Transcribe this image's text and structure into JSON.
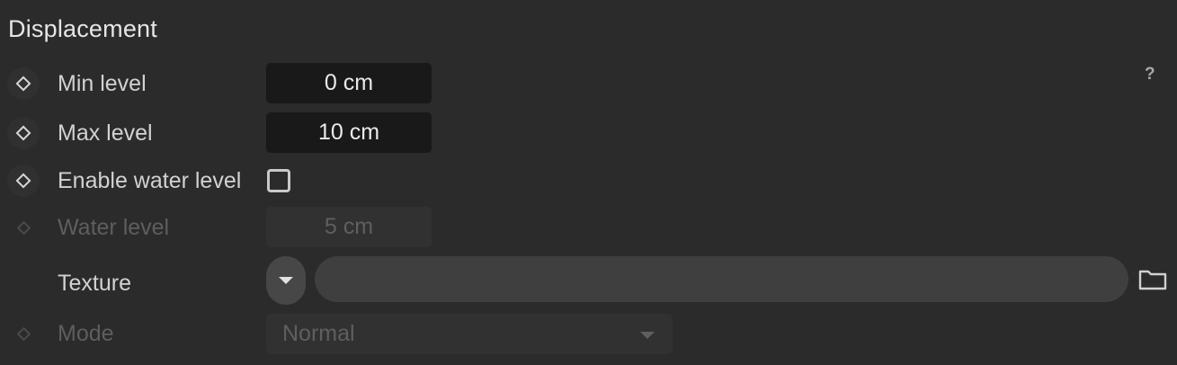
{
  "section": {
    "title": "Displacement",
    "help_label": "?"
  },
  "rows": {
    "min_level": {
      "label": "Min level",
      "value": "0 cm"
    },
    "max_level": {
      "label": "Max level",
      "value": "10 cm"
    },
    "enable_water_level": {
      "label": "Enable water level",
      "checked": false
    },
    "water_level": {
      "label": "Water level",
      "value": "5 cm",
      "enabled": false
    },
    "texture": {
      "label": "Texture",
      "path": ""
    },
    "mode": {
      "label": "Mode",
      "value": "Normal",
      "enabled": false
    }
  },
  "icons": {
    "keyframe": "keyframe-diamond-icon",
    "help": "help-icon",
    "dropdown": "chevron-down-icon",
    "folder": "folder-icon"
  },
  "colors": {
    "background": "#2b2b2b",
    "field": "#191919",
    "field_disabled": "#313131",
    "text": "#d2d2d2",
    "text_disabled": "#5e5e5e"
  }
}
